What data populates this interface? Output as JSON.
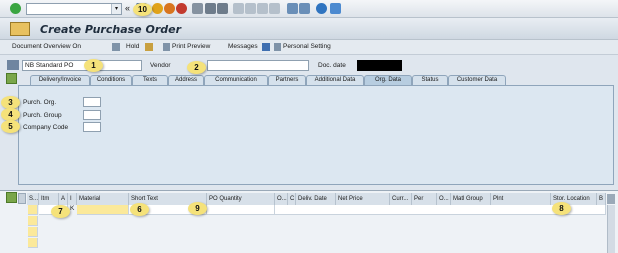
{
  "toolbar": {
    "command_field": "",
    "double_chevron": "«",
    "icons": [
      "ok-icon",
      "save-icon",
      "back-icon",
      "exit-icon",
      "cancel-icon",
      "print-icon",
      "find-icon",
      "find-next-icon",
      "first-page-icon",
      "prev-page-icon",
      "next-page-icon",
      "last-page-icon",
      "new-session-icon",
      "shortcut-icon",
      "help-icon",
      "customize-icon"
    ]
  },
  "title": "Create Purchase Order",
  "app_toolbar": {
    "doc_overview": "Document Overview On",
    "hold": "Hold",
    "print_preview": "Print Preview",
    "messages": "Messages",
    "personal_setting": "Personal Setting"
  },
  "header": {
    "po_type": "NB Standard PO",
    "vendor_label": "Vendor",
    "vendor_value": "",
    "doc_date_label": "Doc. date"
  },
  "tabs": [
    "Delivery/Invoice",
    "Conditions",
    "Texts",
    "Address",
    "Communication",
    "Partners",
    "Additional Data",
    "Org. Data",
    "Status",
    "Customer Data"
  ],
  "active_tab": "Org. Data",
  "org_fields": {
    "purch_org": "Purch. Org.",
    "purch_group": "Purch. Group",
    "company_code": "Company Code"
  },
  "grid_headers": [
    "S...",
    "Itm",
    "A",
    "I",
    "Material",
    "Short Text",
    "PO Quantity",
    "O...",
    "C",
    "Deliv. Date",
    "Net Price",
    "Curr...",
    "Per",
    "O...",
    "Matl Group",
    "Plnt",
    "Stor. Location",
    "B"
  ],
  "grid_first_row": {
    "account_cat": "K"
  },
  "badges": [
    "1",
    "2",
    "3",
    "4",
    "5",
    "6",
    "7",
    "8",
    "9",
    "10"
  ],
  "colors": {
    "badge": "#f5e27a",
    "tab_active": "#b7cde0",
    "panel": "#dce7f1"
  }
}
